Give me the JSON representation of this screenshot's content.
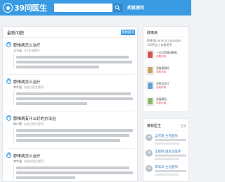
{
  "header": {
    "logo_text": "39问医生",
    "search_placeholder": "",
    "promo_text": "药就便利",
    "brand_color": "#3a9be3"
  },
  "main": {
    "title": "最新问题",
    "more_label": "我要提问",
    "questions": [
      {
        "icon": "问",
        "title": "脖椎病怎么治疗",
        "author": "王子英",
        "meta": "于1年前提问"
      },
      {
        "icon": "问",
        "title": "脖椎病怎么治疗",
        "author": "李华强",
        "meta": "向这位医生提问"
      },
      {
        "icon": "问",
        "title": "脖椎病有什么好的方法治",
        "author": "陈小燕",
        "meta": "向这位医生提问"
      },
      {
        "icon": "问",
        "title": "脖椎病怎么治疗",
        "author": "李华强",
        "meta": "向这位医生提问"
      }
    ]
  },
  "sidebar": {
    "top_title": "脖椎病",
    "line1": "脖椎病(cervical spondylo",
    "line2": "100药品 | 查看更多",
    "products": [
      {
        "name": "一品红脖椎病颗粒",
        "tag": "查看详情",
        "color": "#d9534f"
      },
      {
        "name": "颈复康颗粒",
        "tag": "查看详情",
        "color": "#c8a060"
      },
      {
        "name": "舒筋活血片",
        "tag": "查看详情",
        "color": "#6a9fd4"
      },
      {
        "name": "颈痛颗粒",
        "tag": "查看详情",
        "color": "#8bb66a"
      }
    ],
    "doctors_title": "推荐医生",
    "doctors_more": "更多",
    "doctors": [
      {
        "name": "孟宪丽 主任医师"
      },
      {
        "name": "王建刚 副主任医师"
      },
      {
        "name": "李清华 主治医师"
      }
    ]
  }
}
